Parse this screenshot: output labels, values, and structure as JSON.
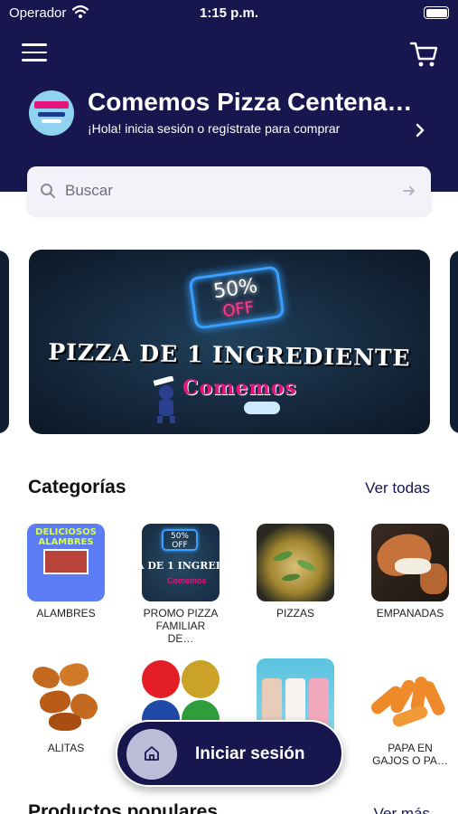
{
  "status_bar": {
    "carrier": "Operador",
    "time": "1:15 p.m."
  },
  "header": {
    "store_name": "Comemos Pizza Centena…",
    "subtitle": "¡Hola! inicia sesión o regístrate para comprar",
    "background": "#17164f"
  },
  "search": {
    "placeholder": "Buscar",
    "value": ""
  },
  "banner": {
    "badge_percent": "50%",
    "badge_off": "OFF",
    "headline": "PIZZA DE 1 INGREDIENTE",
    "brand": "Comemos"
  },
  "categories": {
    "title": "Categorías",
    "see_all": "Ver todas",
    "items": [
      {
        "label": "ALAMBRES",
        "image_text": "DELICIOSOS ALAMBRES"
      },
      {
        "label": "PROMO PIZZA FAMILIAR DE…",
        "image_badge": "50% OFF",
        "image_text": "A DE 1 INGREDI",
        "image_brand": "Comemos"
      },
      {
        "label": "PIZZAS"
      },
      {
        "label": "EMPANADAS"
      },
      {
        "label": "ALITAS"
      },
      {
        "label": ""
      },
      {
        "label": ""
      },
      {
        "label": "PAPA EN GAJOS O PA…"
      }
    ]
  },
  "popular": {
    "title": "Productos populares",
    "see_more": "Ver más"
  },
  "login_button": {
    "label": "Iniciar sesión",
    "icon": "home-icon"
  },
  "colors": {
    "brand_navy": "#17164f",
    "accent_pink": "#e4147b"
  }
}
